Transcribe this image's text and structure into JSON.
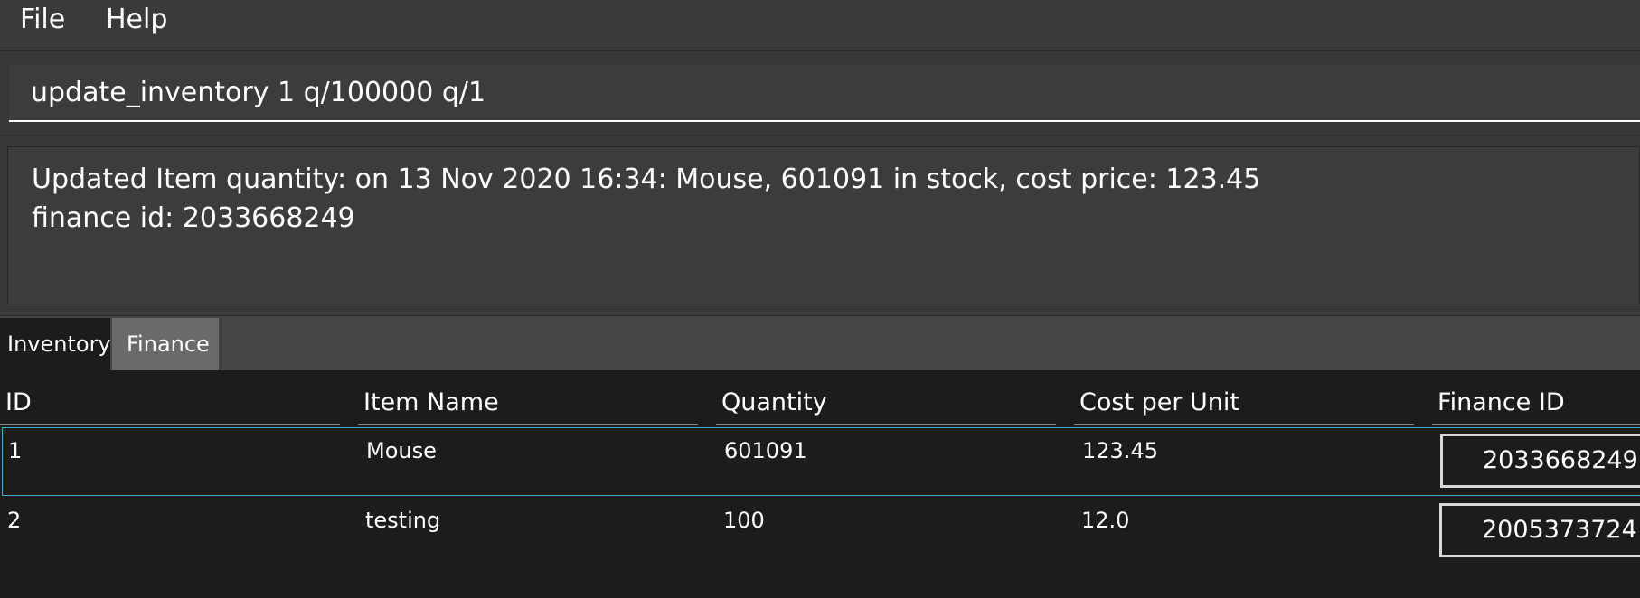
{
  "menu": {
    "file_label": "File",
    "help_label": "Help"
  },
  "command": {
    "value": "update_inventory 1 q/100000 q/1"
  },
  "result": {
    "text": "Updated Item quantity: on 13 Nov 2020 16:34: Mouse, 601091 in stock, cost price: 123.45\nfinance id: 2033668249"
  },
  "tabs": [
    {
      "label": "Inventory",
      "selected": true
    },
    {
      "label": "Finance",
      "selected": false
    }
  ],
  "table": {
    "columns": [
      "ID",
      "Item Name",
      "Quantity",
      "Cost per Unit",
      "Finance ID"
    ],
    "rows": [
      {
        "id": "1",
        "name": "Mouse",
        "quantity": "601091",
        "cost": "123.45",
        "finance_id": "2033668249",
        "selected": true
      },
      {
        "id": "2",
        "name": "testing",
        "quantity": "100",
        "cost": "12.0",
        "finance_id": "2005373724",
        "selected": false
      }
    ]
  },
  "colors": {
    "selection_border": "#3fa9d6",
    "background": "#1c1c1c",
    "panel": "#3c3c3c"
  }
}
